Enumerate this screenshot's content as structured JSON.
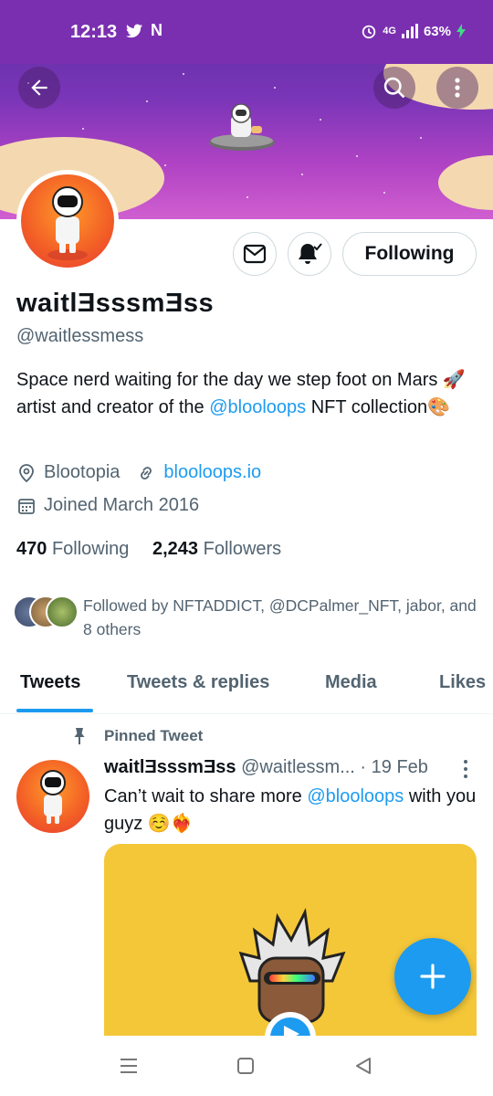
{
  "status_bar": {
    "time": "12:13",
    "network": "4G",
    "battery": "63%"
  },
  "header": {
    "back_icon": "arrow-left-icon",
    "search_icon": "search-icon",
    "more_icon": "more-vertical-icon"
  },
  "profile": {
    "display_name": "waitlƎsssmƎss",
    "handle": "@waitlessmess",
    "bio_prefix": "Space nerd waiting for the day we step foot on Mars 🚀 artist and creator of the ",
    "bio_link": "@blooloops",
    "bio_suffix": " NFT collection🎨",
    "location": "Blootopia",
    "website": "blooloops.io",
    "joined": "Joined March 2016",
    "following_count": "470",
    "following_label": "Following",
    "followers_count": "2,243",
    "followers_label": "Followers",
    "followed_by": "Followed by NFTADDICT, @DCPalmer_NFT, jabor, and 8 others",
    "follow_button": "Following"
  },
  "tabs": [
    {
      "label": "Tweets",
      "active": true
    },
    {
      "label": "Tweets & replies",
      "active": false
    },
    {
      "label": "Media",
      "active": false
    },
    {
      "label": "Likes",
      "active": false
    }
  ],
  "tweet": {
    "pinned_label": "Pinned Tweet",
    "author_name": "waitlƎsssmƎss",
    "author_handle": "@waitlessm...",
    "date": "· 19 Feb",
    "text_prefix": "Can’t wait to share more ",
    "text_link": "@blooloops",
    "text_suffix": " with you guyz ☺️❤️‍🔥"
  },
  "colors": {
    "accent": "#1d9bf0",
    "status_bar": "#7a2fb0",
    "secondary_text": "#536471"
  }
}
